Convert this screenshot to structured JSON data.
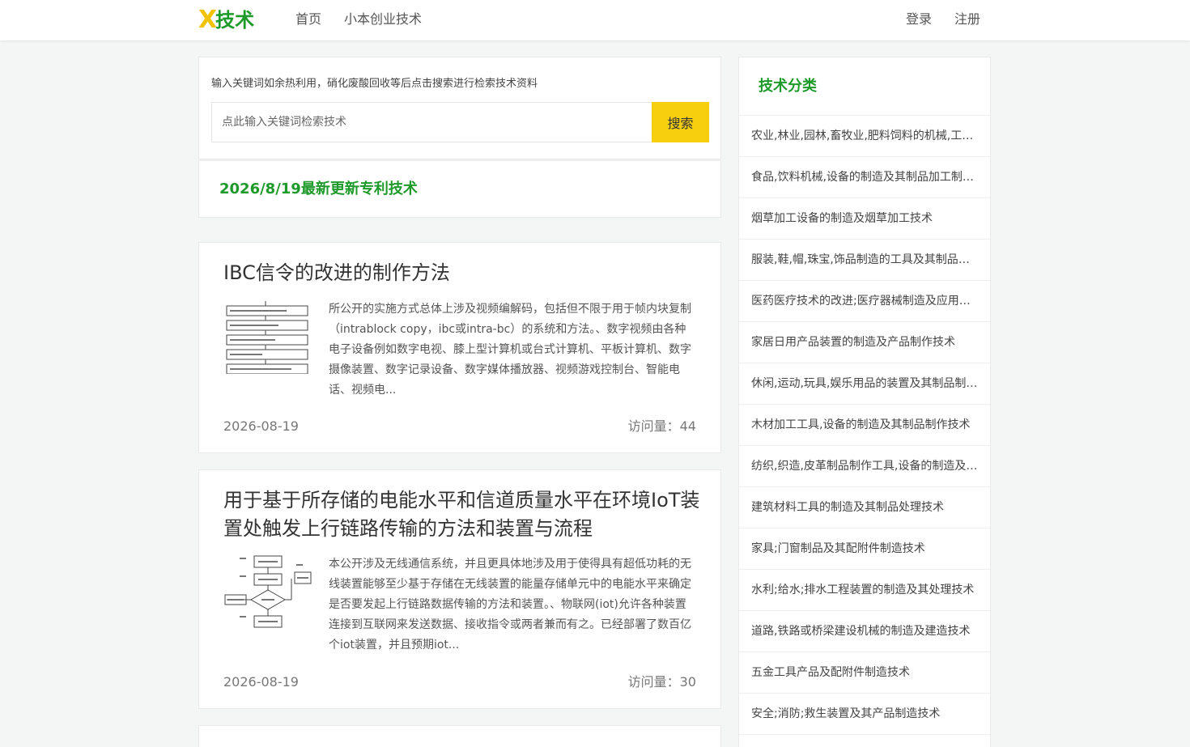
{
  "header": {
    "logo_mark": "X",
    "logo_text": "技术",
    "nav": [
      "首页",
      "小本创业技术"
    ],
    "login": "登录",
    "register": "注册"
  },
  "search": {
    "hint": "输入关键词如余热利用，硝化废酸回收等后点击搜索进行检索技术资料",
    "placeholder": "点此输入关键词检索技术",
    "button": "搜索"
  },
  "latest": {
    "title": "2026/8/19最新更新专利技术"
  },
  "articles": [
    {
      "title": "IBC信令的改进的制作方法",
      "desc": "所公开的实施方式总体上涉及视频编解码，包括但不限于用于帧内块复制（intrablock copy，ibc或intra-bc）的系统和方法。、数字视频由各种电子设备例如数字电视、膝上型计算机或台式计算机、平板计算机、数字摄像装置、数字记录设备、数字媒体播放器、视频游戏控制台、智能电话、视频电...",
      "date": "2026-08-19",
      "views": "访问量：44"
    },
    {
      "title": "用于基于所存储的电能水平和信道质量水平在环境IoT装置处触发上行链路传输的方法和装置与流程",
      "desc": "本公开涉及无线通信系统，并且更具体地涉及用于使得具有超低功耗的无线装置能够至少基于存储在无线装置的能量存储单元中的电能水平来确定是否要发起上行链路数据传输的方法和装置。、物联网(iot)允许各种装置连接到互联网来发送数据、接收指令或两者兼而有之。已经部署了数百亿个iot装置，并且预期iot...",
      "date": "2026-08-19",
      "views": "访问量：30"
    }
  ],
  "sidebar": {
    "title": "技术分类",
    "categories": [
      "农业,林业,园林,畜牧业,肥料饲料的机械,工具的制造及其加工技术",
      "食品,饮料机械,设备的制造及其制品加工制作,储藏技术",
      "烟草加工设备的制造及烟草加工技术",
      "服装,鞋,帽,珠宝,饰品制造的工具及其制品技术",
      "医药医疗技术的改进;医疗器械制造及应用技术",
      "家居日用产品装置的制造及产品制作技术",
      "休闲,运动,玩具,娱乐用品的装置及其制品制作技术",
      "木材加工工具,设备的制造及其制品制作技术",
      "纺织,织造,皮革制品制作工具,设备的制造及其制品制作技术",
      "建筑材料工具的制造及其制品处理技术",
      "家具;门窗制品及其配附件制造技术",
      "水利;给水;排水工程装置的制造及其处理技术",
      "道路,铁路或桥梁建设机械的制造及建造技术",
      "五金工具产品及配附件制造技术",
      "安全;消防;救生装置及其产品制造技术"
    ]
  }
}
